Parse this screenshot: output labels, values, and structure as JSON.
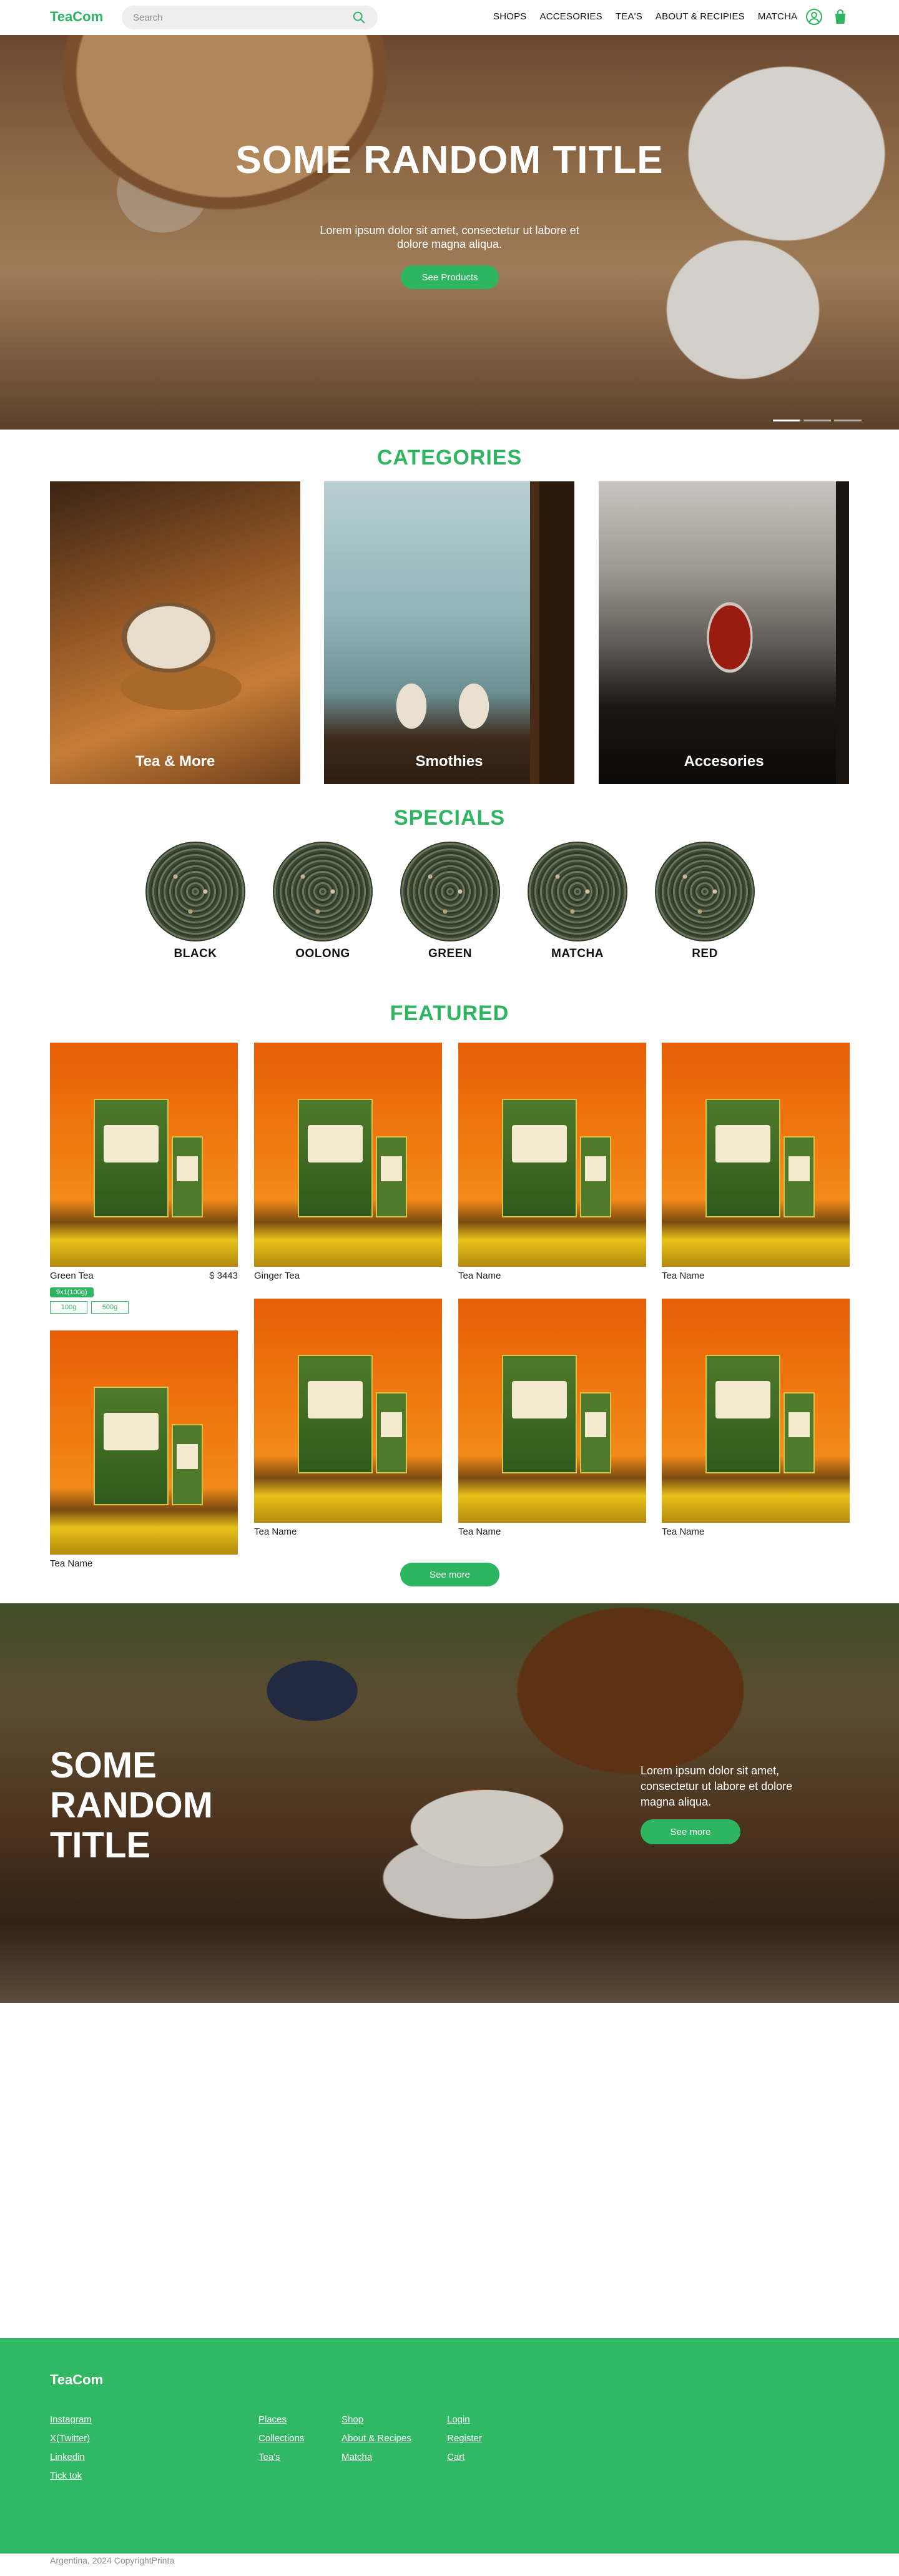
{
  "nav": {
    "logo": "TeaCom",
    "search_placeholder": "Search",
    "links": [
      "SHOPS",
      "ACCESORIES",
      "TEA'S",
      "ABOUT & RECIPIES",
      "MATCHA"
    ],
    "icons": [
      "user-icon",
      "cart-icon"
    ]
  },
  "hero": {
    "title": "SOME RANDOM TITLE",
    "subtitle": "Lorem ipsum dolor sit amet, consectetur ut labore et dolore magna aliqua.",
    "button": "See Products",
    "slides": 3,
    "active_slide": 1
  },
  "categories": {
    "title": "CATEGORIES",
    "items": [
      {
        "label": "Tea & More"
      },
      {
        "label": "Smothies"
      },
      {
        "label": "Accesories"
      }
    ]
  },
  "specials": {
    "title": "SPECIALS",
    "items": [
      "BLACK",
      "OOLONG",
      "GREEN",
      "MATCHA",
      "RED"
    ]
  },
  "featured": {
    "title": "FEATURED",
    "products": [
      {
        "name": "Green Tea",
        "price": "$ 3443",
        "promo": "9x1(100g)",
        "sizes": [
          "100g",
          "500g"
        ]
      },
      {
        "name": "Ginger Tea",
        "price": ""
      },
      {
        "name": "Tea Name",
        "price": ""
      },
      {
        "name": "Tea Name",
        "price": ""
      },
      {
        "name": "Tea Name",
        "price": ""
      },
      {
        "name": "Tea Name",
        "price": ""
      },
      {
        "name": "Tea Name",
        "price": ""
      },
      {
        "name": "Tea Name",
        "price": ""
      }
    ],
    "more_button": "See more"
  },
  "banner": {
    "title": "SOME RANDOM TITLE",
    "text": "Lorem ipsum dolor sit amet, consectetur ut labore et dolore magna aliqua.",
    "button": "See more"
  },
  "footer": {
    "logo": "TeaCom",
    "col1": [
      "Instagram",
      "X(Twitter)",
      "Linkedin",
      "Tick tok"
    ],
    "col2": [
      "Places",
      "Collections",
      "Tea's"
    ],
    "col3": [
      "Shop",
      "About & Recipes",
      "Matcha"
    ],
    "col4": [
      "Login",
      "Register",
      "Cart"
    ],
    "copyright": "Argentina, 2024 CopyrightPrinta"
  },
  "colors": {
    "accent": "#2db560",
    "footer": "#31b862"
  }
}
